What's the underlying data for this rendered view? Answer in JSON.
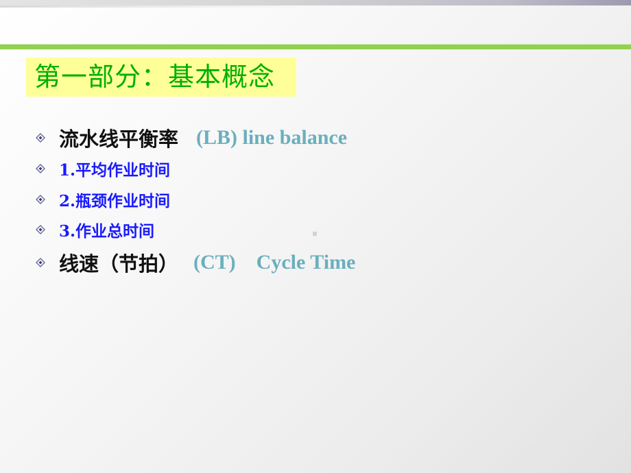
{
  "slide": {
    "title": "第一部分：基本概念",
    "items": [
      {
        "text_cn": "流水线平衡率",
        "text_en": "(LB)  line balance"
      },
      {
        "text_cn": "1.平均作业时间"
      },
      {
        "text_cn": "2.瓶颈作业时间"
      },
      {
        "text_cn": "3.作业总时间"
      },
      {
        "text_cn": "线速（节拍）",
        "text_en": "(CT)    Cycle Time"
      }
    ]
  },
  "colors": {
    "title_green": "#00b000",
    "title_highlight": "#ffff99",
    "rule_green": "#92d050",
    "teal": "#6aafbd",
    "blue": "#1a1aff"
  }
}
